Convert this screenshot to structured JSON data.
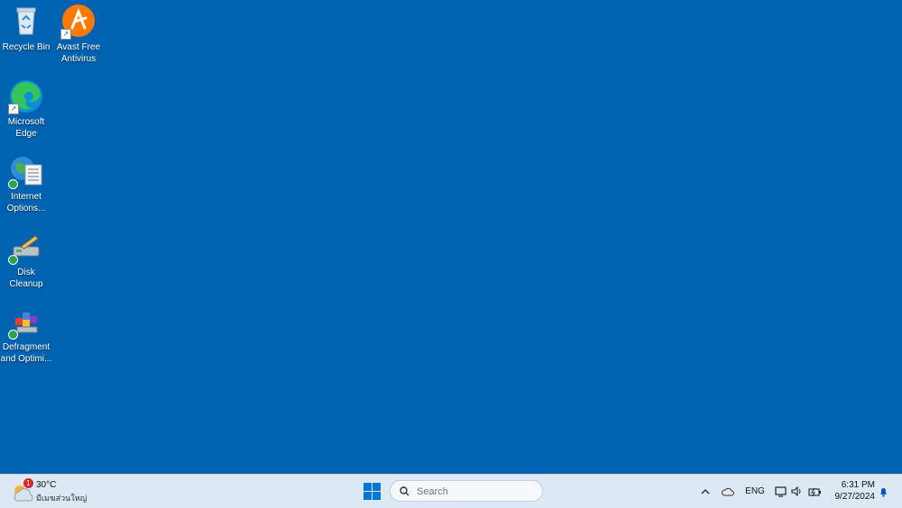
{
  "desktop": {
    "icons": [
      {
        "label": "Recycle Bin"
      },
      {
        "label": "Avast Free Antivirus"
      },
      {
        "label": "Microsoft Edge"
      },
      {
        "label": "Internet Options..."
      },
      {
        "label": "Disk Cleanup"
      },
      {
        "label": "Defragment and Optimi..."
      }
    ]
  },
  "taskbar": {
    "weather": {
      "temp": "30°C",
      "condition": "มีเมฆส่วนใหญ่",
      "badge": "1"
    },
    "search": {
      "placeholder": "Search"
    },
    "tray": {
      "language": "ENG"
    },
    "clock": {
      "time": "6:31 PM",
      "date": "9/27/2024"
    }
  },
  "colors": {
    "desktop_bg": "#0063b1",
    "taskbar_bg": "#dce8f4",
    "accent": "#0078d4"
  }
}
